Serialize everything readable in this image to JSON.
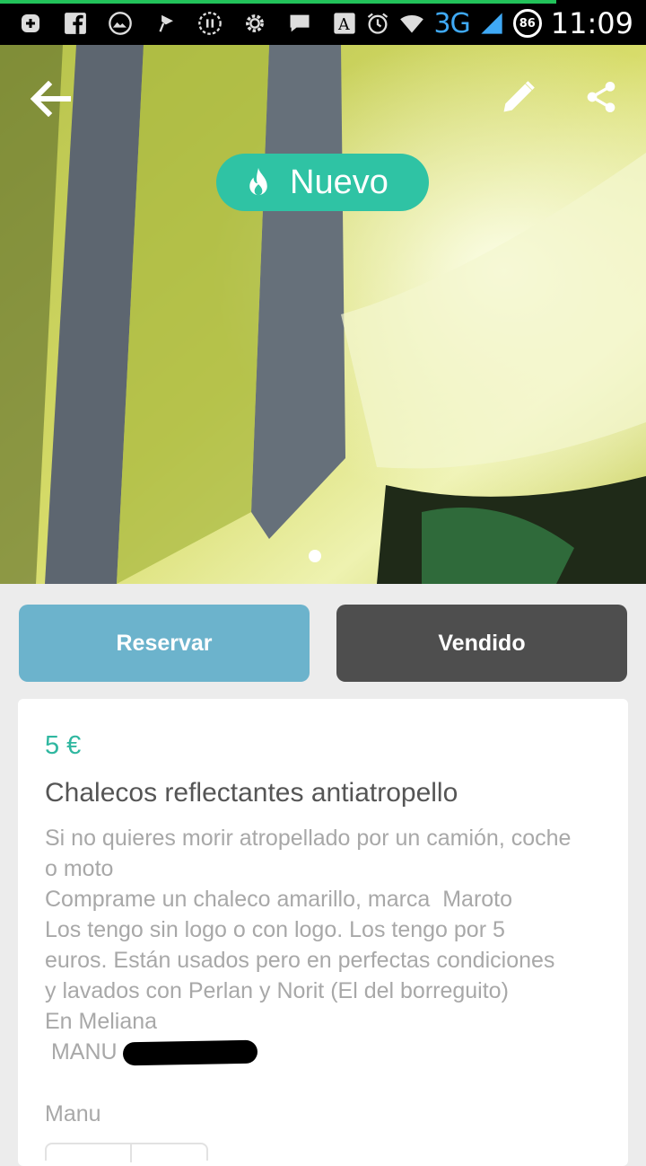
{
  "status_bar": {
    "network": "3G",
    "battery": "86",
    "time": "11:09",
    "icons": [
      "plus-box-icon",
      "facebook-icon",
      "image-icon",
      "pin-flag-icon",
      "pause-circle-icon",
      "gear-icon",
      "chat-icon",
      "font-app-icon",
      "alarm-icon",
      "wifi-icon",
      "signal-icon"
    ]
  },
  "header": {
    "badge_label": "Nuevo",
    "badge_icon": "flame-icon",
    "badge_color": "#2fc3a4",
    "back_icon": "back-arrow-icon",
    "edit_icon": "pencil-icon",
    "share_icon": "share-icon"
  },
  "actions": {
    "reserve_label": "Reservar",
    "sold_label": "Vendido",
    "reserve_color": "#6cb3cc",
    "sold_color": "#4e4e4e"
  },
  "listing": {
    "price": "5 €",
    "title": "Chalecos reflectantes antiatropello",
    "description_lines": [
      "Si no quieres morir atropellado por un camión, coche",
      "o moto",
      "Comprame un chaleco amarillo, marca  Maroto",
      "Los tengo sin logo o con logo. Los tengo por 5",
      "euros. Están usados pero en perfectas condiciones",
      "y lavados con Perlan y Norit (El del borreguito)",
      "En Meliana",
      " MANU"
    ],
    "seller": "Manu"
  }
}
